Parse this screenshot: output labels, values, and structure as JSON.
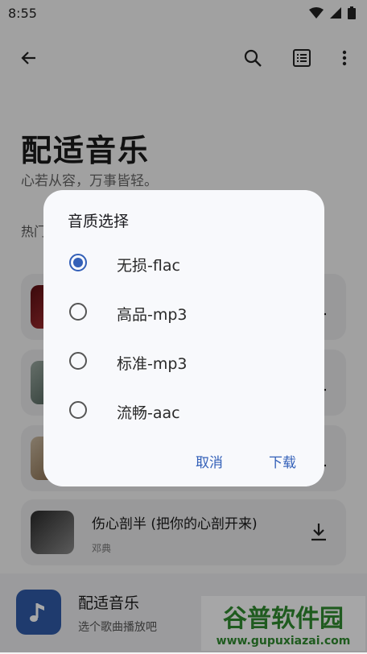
{
  "status": {
    "time": "8:55"
  },
  "header": {
    "title": "配适音乐",
    "subtitle": "心若从容，万事皆轻。",
    "section": "热门"
  },
  "songs": [
    {
      "title": "",
      "artist": ""
    },
    {
      "title": "",
      "artist": ""
    },
    {
      "title": "",
      "artist": ""
    },
    {
      "title": "伤心剖半 (把你的心剖开来)",
      "artist": "邓典"
    }
  ],
  "player": {
    "title": "配适音乐",
    "subtitle": "选个歌曲播放吧"
  },
  "dialog": {
    "title": "音质选择",
    "options": [
      {
        "label": "无损-flac",
        "checked": true
      },
      {
        "label": "高品-mp3",
        "checked": false
      },
      {
        "label": "标准-mp3",
        "checked": false
      },
      {
        "label": "流畅-aac",
        "checked": false
      }
    ],
    "cancel_label": "取消",
    "confirm_label": "下载"
  },
  "watermark": {
    "brand": "谷普软件园",
    "url": "www.gupuxiazai.com"
  },
  "colors": {
    "accent": "#3360b8",
    "player_icon_bg": "#2f5aa8"
  }
}
